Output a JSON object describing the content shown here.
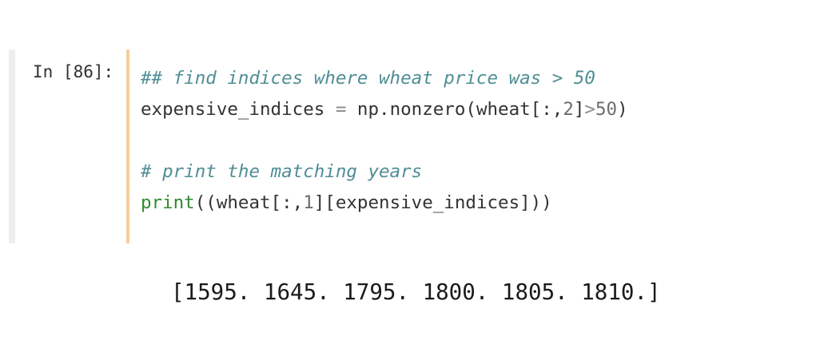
{
  "cell": {
    "prompt": "In [86]:",
    "lines": [
      [
        {
          "text": "## find indices where wheat price was > 50",
          "kind": "comment"
        }
      ],
      [
        {
          "text": "expensive_indices",
          "kind": "plain"
        },
        {
          "text": " ",
          "kind": "plain"
        },
        {
          "text": "=",
          "kind": "op"
        },
        {
          "text": " np.nonzero(wheat[:,",
          "kind": "plain"
        },
        {
          "text": "2",
          "kind": "num"
        },
        {
          "text": "]",
          "kind": "plain"
        },
        {
          "text": ">",
          "kind": "op"
        },
        {
          "text": "50",
          "kind": "num"
        },
        {
          "text": ")",
          "kind": "plain"
        }
      ],
      [],
      [
        {
          "text": "# print the matching years",
          "kind": "comment"
        }
      ],
      [
        {
          "text": "print",
          "kind": "builtin"
        },
        {
          "text": "((wheat[:,",
          "kind": "plain"
        },
        {
          "text": "1",
          "kind": "num"
        },
        {
          "text": "][expensive_indices]))",
          "kind": "plain"
        }
      ]
    ]
  },
  "output": {
    "text": "[1595. 1645. 1795. 1800. 1805. 1810.]"
  }
}
